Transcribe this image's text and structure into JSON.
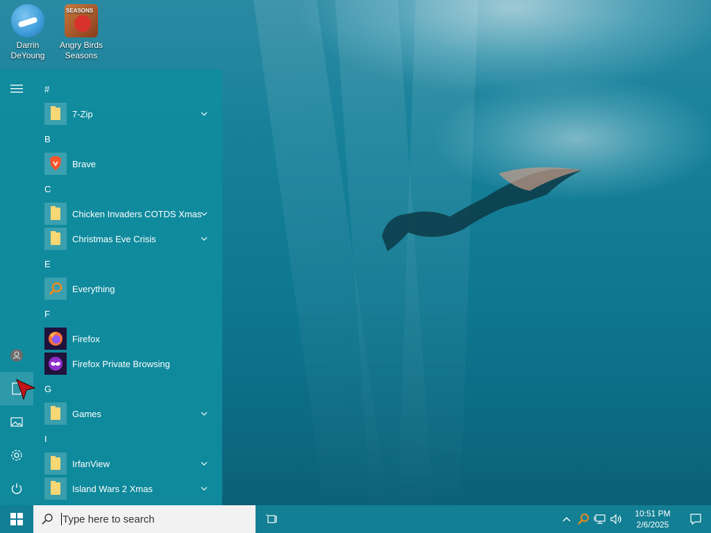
{
  "desktop": {
    "icons": [
      {
        "label_line1": "Darrin",
        "label_line2": "DeYoung",
        "icon": "darrin-app-icon"
      },
      {
        "label_line1": "Angry Birds",
        "label_line2": "Seasons",
        "icon": "angry-birds-icon"
      }
    ]
  },
  "start_menu": {
    "rail": [
      "hamburger-icon",
      "user-icon",
      "documents-icon",
      "pictures-icon",
      "settings-icon",
      "power-icon"
    ],
    "sections": [
      {
        "letter": "#",
        "apps": [
          {
            "name": "7-Zip",
            "icon": "folder-icon",
            "expandable": true
          }
        ]
      },
      {
        "letter": "B",
        "apps": [
          {
            "name": "Brave",
            "icon": "brave-icon",
            "expandable": false
          }
        ]
      },
      {
        "letter": "C",
        "apps": [
          {
            "name": "Chicken Invaders COTDS Xmas",
            "icon": "folder-icon",
            "expandable": true
          },
          {
            "name": "Christmas Eve Crisis",
            "icon": "folder-icon",
            "expandable": true
          }
        ]
      },
      {
        "letter": "E",
        "apps": [
          {
            "name": "Everything",
            "icon": "everything-icon",
            "expandable": false
          }
        ]
      },
      {
        "letter": "F",
        "apps": [
          {
            "name": "Firefox",
            "icon": "firefox-icon",
            "expandable": false
          },
          {
            "name": "Firefox Private Browsing",
            "icon": "firefox-private-icon",
            "expandable": false
          }
        ]
      },
      {
        "letter": "G",
        "apps": [
          {
            "name": "Games",
            "icon": "folder-icon",
            "expandable": true
          }
        ]
      },
      {
        "letter": "I",
        "apps": [
          {
            "name": "IrfanView",
            "icon": "folder-icon",
            "expandable": true
          },
          {
            "name": "Island Wars 2 Xmas",
            "icon": "folder-icon",
            "expandable": true
          }
        ]
      }
    ]
  },
  "taskbar": {
    "search_placeholder": "Type here to search",
    "time": "10:51 PM",
    "date": "2/6/2025"
  },
  "colors": {
    "start_menu_bg": "#108c9e",
    "taskbar_bg": "#127f94",
    "folder": "#f8d775"
  }
}
